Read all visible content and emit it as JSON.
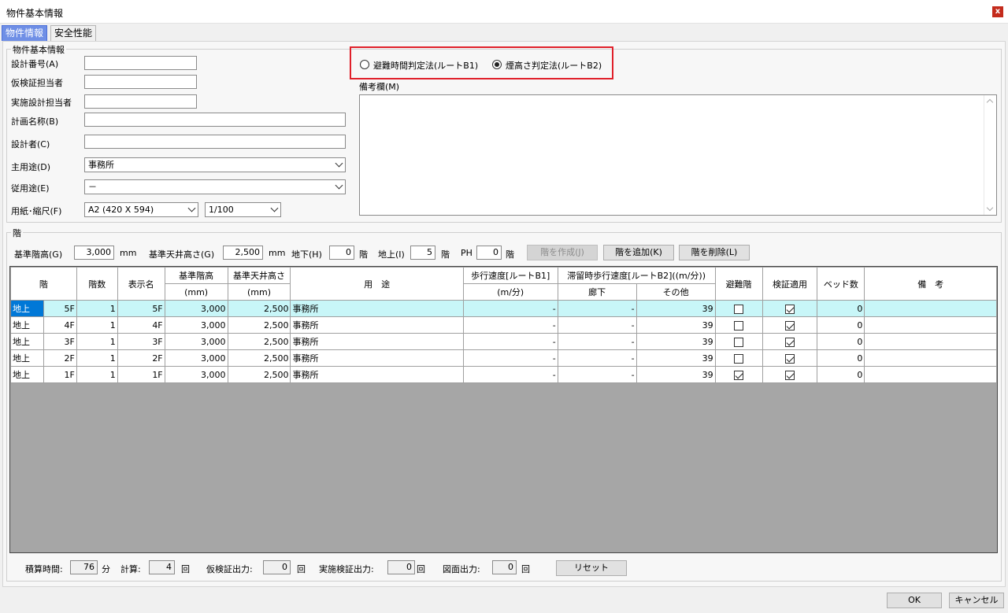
{
  "window": {
    "title": "物件基本情報",
    "close": "x"
  },
  "tabs": [
    {
      "label": "物件情報"
    },
    {
      "label": "安全性能"
    }
  ],
  "basic": {
    "group_label": "物件基本情報",
    "design_no": {
      "label": "設計番号(A)",
      "value": ""
    },
    "temp_verifier": {
      "label": "仮検証担当者",
      "value": ""
    },
    "design_staff": {
      "label": "実施設計担当者",
      "value": ""
    },
    "plan_name": {
      "label": "計画名称(B)",
      "value": ""
    },
    "designer": {
      "label": "設計者(C)",
      "value": ""
    },
    "main_use": {
      "label": "主用途(D)",
      "value": "事務所"
    },
    "sub_use": {
      "label": "従用途(E)",
      "value": "－"
    },
    "paper": {
      "label": "用紙･縮尺(F)",
      "size": "A2 (420 X 594)",
      "scale": "1/100"
    }
  },
  "route": {
    "b1": {
      "label": "避難時間判定法(ルートB1)",
      "selected": false
    },
    "b2": {
      "label": "煙高さ判定法(ルートB2)",
      "selected": true
    }
  },
  "memo": {
    "label": "備考欄(M)",
    "value": ""
  },
  "floors": {
    "group_label": "階",
    "std_height_label": "基準階高(G)",
    "std_height": "3,000",
    "mm1": "mm",
    "std_ceiling_label": "基準天井高さ(G)",
    "std_ceiling": "2,500",
    "mm2": "mm",
    "underground_label": "地下(H)",
    "underground": "0",
    "kai1": "階",
    "above_label": "地上(I)",
    "above": "5",
    "kai2": "階",
    "ph_label": "PH",
    "ph": "0",
    "kai3": "階",
    "create_btn": "階を作成(J)",
    "add_btn": "階を追加(K)",
    "delete_btn": "階を削除(L)"
  },
  "table": {
    "headers": {
      "floor": "階",
      "count": "階数",
      "display": "表示名",
      "std_h": "基準階高",
      "std_h_unit": "(mm)",
      "ceil": "基準天井高さ",
      "ceil_unit": "(mm)",
      "use": "用　途",
      "walk": "歩行速度[ルートB1]",
      "walk_unit": "(m/分)",
      "stay": "滞留時歩行速度[ルートB2]((m/分))",
      "stay_corridor": "廊下",
      "stay_other": "その他",
      "refuge": "避難階",
      "verify": "検証適用",
      "beds": "ベッド数",
      "note": "備　考"
    },
    "rows": [
      {
        "kind": "地上",
        "fl": "5F",
        "count": "1",
        "name": "5F",
        "h": "3,000",
        "c": "2,500",
        "use": "事務所",
        "walk": "-",
        "corr": "-",
        "other": "39",
        "refuge": false,
        "verify": true,
        "beds": "0",
        "note": ""
      },
      {
        "kind": "地上",
        "fl": "4F",
        "count": "1",
        "name": "4F",
        "h": "3,000",
        "c": "2,500",
        "use": "事務所",
        "walk": "-",
        "corr": "-",
        "other": "39",
        "refuge": false,
        "verify": true,
        "beds": "0",
        "note": ""
      },
      {
        "kind": "地上",
        "fl": "3F",
        "count": "1",
        "name": "3F",
        "h": "3,000",
        "c": "2,500",
        "use": "事務所",
        "walk": "-",
        "corr": "-",
        "other": "39",
        "refuge": false,
        "verify": true,
        "beds": "0",
        "note": ""
      },
      {
        "kind": "地上",
        "fl": "2F",
        "count": "1",
        "name": "2F",
        "h": "3,000",
        "c": "2,500",
        "use": "事務所",
        "walk": "-",
        "corr": "-",
        "other": "39",
        "refuge": false,
        "verify": true,
        "beds": "0",
        "note": ""
      },
      {
        "kind": "地上",
        "fl": "1F",
        "count": "1",
        "name": "1F",
        "h": "3,000",
        "c": "2,500",
        "use": "事務所",
        "walk": "-",
        "corr": "-",
        "other": "39",
        "refuge": true,
        "verify": true,
        "beds": "0",
        "note": ""
      }
    ]
  },
  "stats": {
    "time_label": "積算時間:",
    "time": "76",
    "min": "分",
    "calc_label": "計算:",
    "calc": "4",
    "kai_a": "回",
    "temp_out_label": "仮検証出力:",
    "temp_out": "0",
    "kai_b": "回",
    "impl_out_label": "実施検証出力:",
    "impl_out": "0",
    "kai_c": "回",
    "drawing_out_label": "図面出力:",
    "drawing_out": "0",
    "kai_d": "回",
    "reset_btn": "リセット"
  },
  "dialog": {
    "ok": "OK",
    "cancel": "キャンセル"
  }
}
